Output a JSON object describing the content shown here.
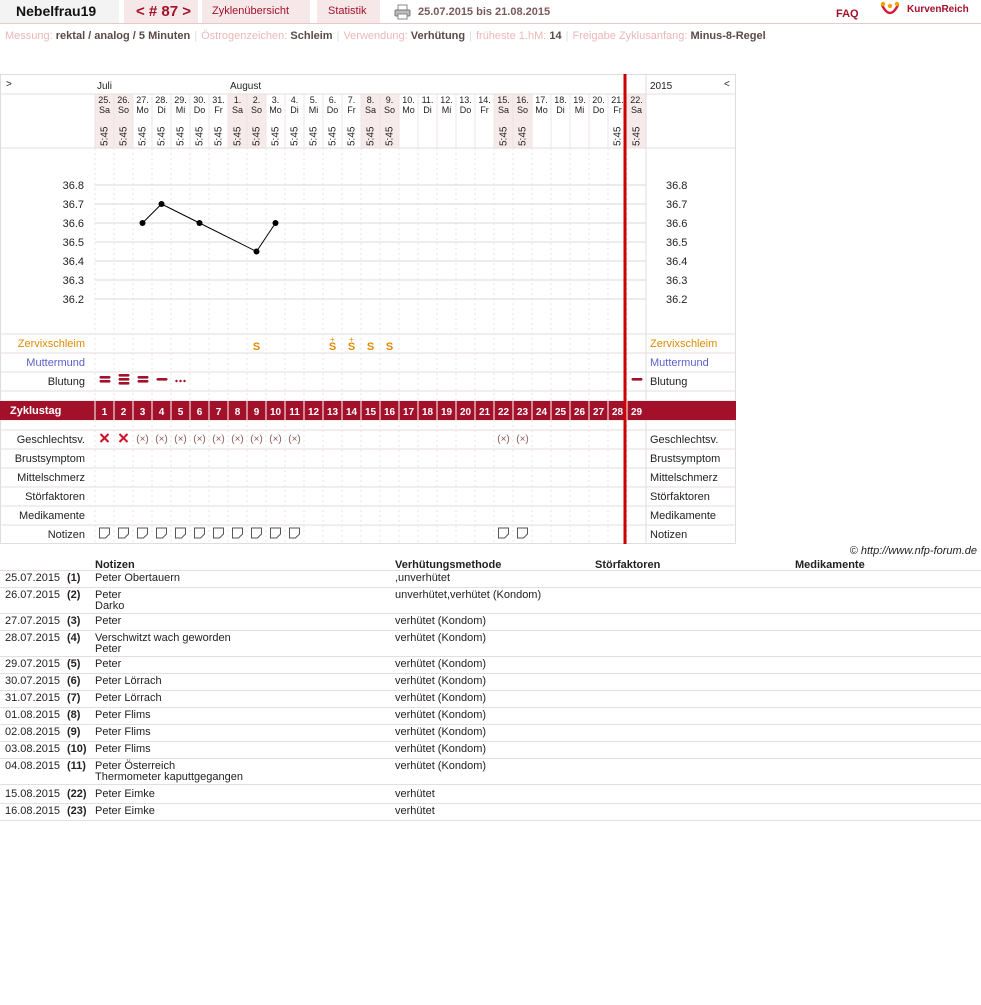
{
  "topbar": {
    "username": "Nebelfrau19",
    "cycle_nav": "< # 87 >",
    "overview": "Zyklenübersicht",
    "stats": "Statistik",
    "date_range": "25.07.2015 bis 21.08.2015",
    "faq": "FAQ",
    "logo": "KurvenReich"
  },
  "infobar": [
    {
      "label": "Messung:",
      "value": "rektal / analog / 5 Minuten"
    },
    {
      "label": "Östrogenzeichen:",
      "value": "Schleim"
    },
    {
      "label": "Verwendung:",
      "value": "Verhütung"
    },
    {
      "label": "früheste 1.hM:",
      "value": "14"
    },
    {
      "label": "Freigabe Zyklusanfang:",
      "value": "Minus-8-Regel"
    }
  ],
  "chart_data": {
    "type": "line",
    "nav_prev": ">",
    "nav_next": "<",
    "year": "2015",
    "months": [
      {
        "label": "Juli",
        "day_index": 0
      },
      {
        "label": "August",
        "day_index": 7
      }
    ],
    "dates": [
      "25.",
      "26.",
      "27.",
      "28.",
      "29.",
      "30.",
      "31.",
      "1.",
      "2.",
      "3.",
      "4.",
      "5.",
      "6.",
      "7.",
      "8.",
      "9.",
      "10.",
      "11.",
      "12.",
      "13.",
      "14.",
      "15.",
      "16.",
      "17.",
      "18.",
      "19.",
      "20.",
      "21.",
      "22."
    ],
    "weekdays": [
      "Sa",
      "So",
      "Mo",
      "Di",
      "Mi",
      "Do",
      "Fr",
      "Sa",
      "So",
      "Mo",
      "Di",
      "Mi",
      "Do",
      "Fr",
      "Sa",
      "So",
      "Mo",
      "Di",
      "Mi",
      "Do",
      "Fr",
      "Sa",
      "So",
      "Mo",
      "Di",
      "Mi",
      "Do",
      "Fr",
      "Sa"
    ],
    "weekend_days": [
      1,
      2,
      8,
      9,
      15,
      16,
      22,
      23,
      29
    ],
    "times": [
      "5:45",
      "5:45",
      "5:45",
      "5:45",
      "5:45",
      "5:45",
      "5:45",
      "5:45",
      "5:45",
      "5:45",
      "5:45",
      "5:45",
      "5:45",
      "5:45",
      "5:45",
      "5:45",
      "",
      "",
      "",
      "",
      "",
      "5:45",
      "5:45",
      "",
      "",
      "",
      "",
      "5:45",
      "5:45"
    ],
    "y_ticks": [
      "36.8",
      "36.7",
      "36.6",
      "36.5",
      "36.4",
      "36.3",
      "36.2"
    ],
    "ylim": [
      36.2,
      36.8
    ],
    "temperature": [
      {
        "day": 3,
        "value": 36.6
      },
      {
        "day": 4,
        "value": 36.7
      },
      {
        "day": 6,
        "value": 36.6
      },
      {
        "day": 9,
        "value": 36.45
      },
      {
        "day": 10,
        "value": 36.6
      }
    ],
    "cycle_label": "Zyklustag",
    "cycle_days": [
      "1",
      "2",
      "3",
      "4",
      "5",
      "6",
      "7",
      "8",
      "9",
      "10",
      "11",
      "12",
      "13",
      "14",
      "15",
      "16",
      "17",
      "18",
      "19",
      "20",
      "21",
      "22",
      "23",
      "24",
      "25",
      "26",
      "27",
      "28",
      "29"
    ],
    "cervix_row_label": "Zervixschleim",
    "cervix": [
      {
        "day": 9,
        "mark": "S"
      },
      {
        "day": 13,
        "mark": "S+"
      },
      {
        "day": 14,
        "mark": "S+"
      },
      {
        "day": 15,
        "mark": "S"
      },
      {
        "day": 16,
        "mark": "S"
      }
    ],
    "cervix_position_label": "Muttermund",
    "bleeding_label": "Blutung",
    "bleeding": [
      {
        "day": 1,
        "level": "medium"
      },
      {
        "day": 2,
        "level": "heavy"
      },
      {
        "day": 3,
        "level": "medium"
      },
      {
        "day": 4,
        "level": "light"
      },
      {
        "day": 5,
        "level": "spotting"
      },
      {
        "day": 29,
        "level": "light"
      }
    ],
    "sex_label": "Geschlechtsv.",
    "sex": [
      {
        "day": 1,
        "protected": false
      },
      {
        "day": 2,
        "protected": false
      },
      {
        "day": 3,
        "protected": true
      },
      {
        "day": 4,
        "protected": true
      },
      {
        "day": 5,
        "protected": true
      },
      {
        "day": 6,
        "protected": true
      },
      {
        "day": 7,
        "protected": true
      },
      {
        "day": 8,
        "protected": true
      },
      {
        "day": 9,
        "protected": true
      },
      {
        "day": 10,
        "protected": true
      },
      {
        "day": 11,
        "protected": true
      },
      {
        "day": 22,
        "protected": true
      },
      {
        "day": 23,
        "protected": true
      }
    ],
    "other_rows": [
      "Brustsymptom",
      "Mittelschmerz",
      "Störfaktoren",
      "Medikamente"
    ],
    "notes_label": "Notizen",
    "note_days": [
      1,
      2,
      3,
      4,
      5,
      6,
      7,
      8,
      9,
      10,
      11,
      22,
      23
    ],
    "colors": {
      "accent": "#a3102a",
      "cervix": "#e08a00",
      "cervix_position": "#5a5fc8",
      "weekend": "#f7eaea",
      "line": "#000000"
    }
  },
  "credit": "© http://www.nfp-forum.de",
  "notes_table": {
    "headers": {
      "notes": "Notizen",
      "method": "Verhütungsmethode",
      "disturb": "Störfaktoren",
      "meds": "Medikamente"
    },
    "rows": [
      {
        "date": "25.07.2015",
        "day": "(1)",
        "note": "Peter Obertauern",
        "method": ",unverhütet"
      },
      {
        "date": "26.07.2015",
        "day": "(2)",
        "note": "Peter\nDarko",
        "method": "unverhütet,verhütet (Kondom)"
      },
      {
        "date": "27.07.2015",
        "day": "(3)",
        "note": "Peter",
        "method": "verhütet (Kondom)"
      },
      {
        "date": "28.07.2015",
        "day": "(4)",
        "note": "Verschwitzt wach geworden\nPeter",
        "method": "verhütet (Kondom)"
      },
      {
        "date": "29.07.2015",
        "day": "(5)",
        "note": "Peter",
        "method": "verhütet (Kondom)"
      },
      {
        "date": "30.07.2015",
        "day": "(6)",
        "note": "Peter Lörrach",
        "method": "verhütet (Kondom)"
      },
      {
        "date": "31.07.2015",
        "day": "(7)",
        "note": "Peter Lörrach",
        "method": "verhütet (Kondom)"
      },
      {
        "date": "01.08.2015",
        "day": "(8)",
        "note": "Peter Flims",
        "method": "verhütet (Kondom)"
      },
      {
        "date": "02.08.2015",
        "day": "(9)",
        "note": "Peter Flims",
        "method": "verhütet (Kondom)"
      },
      {
        "date": "03.08.2015",
        "day": "(10)",
        "note": "Peter Flims",
        "method": "verhütet (Kondom)"
      },
      {
        "date": "04.08.2015",
        "day": "(11)",
        "note": "Peter Österreich\nThermometer kaputtgegangen",
        "method": "verhütet (Kondom)"
      },
      {
        "date": "15.08.2015",
        "day": "(22)",
        "note": "Peter Eimke",
        "method": "verhütet"
      },
      {
        "date": "16.08.2015",
        "day": "(23)",
        "note": "Peter Eimke",
        "method": "verhütet"
      }
    ]
  }
}
